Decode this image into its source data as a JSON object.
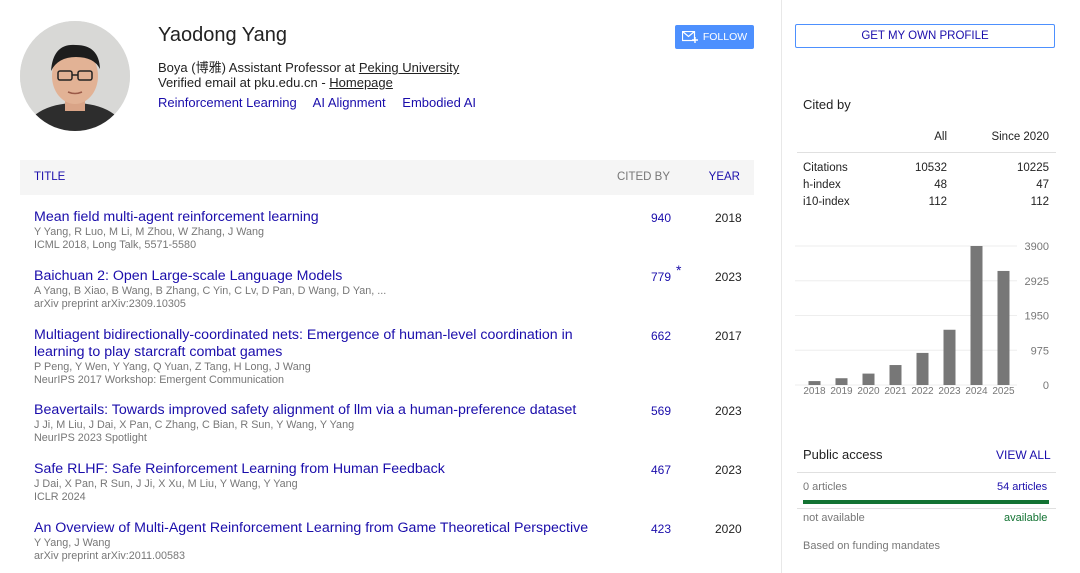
{
  "profile": {
    "name": "Yaodong Yang",
    "affiliation_prefix": "Boya (博雅) Assistant Professor at ",
    "affiliation_link": "Peking University",
    "email_text": "Verified email at pku.edu.cn - ",
    "homepage_link": "Homepage",
    "interests": [
      "Reinforcement Learning",
      "AI Alignment",
      "Embodied AI"
    ],
    "follow_label": "FOLLOW"
  },
  "table": {
    "col_title": "TITLE",
    "col_cited": "CITED BY",
    "col_year": "YEAR"
  },
  "articles": [
    {
      "title": "Mean field multi-agent reinforcement learning",
      "authors": "Y Yang, R Luo, M Li, M Zhou, W Zhang, J Wang",
      "venue": "ICML 2018, Long Talk, 5571-5580",
      "cites": "940",
      "year": "2018",
      "star": ""
    },
    {
      "title": "Baichuan 2: Open Large-scale Language Models",
      "authors": "A Yang, B Xiao, B Wang, B Zhang, C Yin, C Lv, D Pan, D Wang, D Yan, ...",
      "venue": "arXiv preprint arXiv:2309.10305",
      "cites": "779",
      "year": "2023",
      "star": "*"
    },
    {
      "title": "Multiagent bidirectionally-coordinated nets: Emergence of human-level coordination in learning to play starcraft combat games",
      "authors": "P Peng, Y Wen, Y Yang, Q Yuan, Z Tang, H Long, J Wang",
      "venue": "NeurIPS 2017 Workshop: Emergent Communication",
      "cites": "662",
      "year": "2017",
      "star": ""
    },
    {
      "title": "Beavertails: Towards improved safety alignment of llm via a human-preference dataset",
      "authors": "J Ji, M Liu, J Dai, X Pan, C Zhang, C Bian, R Sun, Y Wang, Y Yang",
      "venue": "NeurIPS 2023 Spotlight",
      "cites": "569",
      "year": "2023",
      "star": ""
    },
    {
      "title": "Safe RLHF: Safe Reinforcement Learning from Human Feedback",
      "authors": "J Dai, X Pan, R Sun, J Ji, X Xu, M Liu, Y Wang, Y Yang",
      "venue": "ICLR 2024",
      "cites": "467",
      "year": "2023",
      "star": ""
    },
    {
      "title": "An Overview of Multi-Agent Reinforcement Learning from Game Theoretical Perspective",
      "authors": "Y Yang, J Wang",
      "venue": "arXiv preprint arXiv:2011.00583",
      "cites": "423",
      "year": "2020",
      "star": ""
    }
  ],
  "sidebar": {
    "get_profile_label": "GET MY OWN PROFILE",
    "cited_by_title": "Cited by",
    "col_all": "All",
    "col_since": "Since 2020",
    "rows": [
      {
        "label": "Citations",
        "all": "10532",
        "since": "10225"
      },
      {
        "label": "h-index",
        "all": "48",
        "since": "47"
      },
      {
        "label": "i10-index",
        "all": "112",
        "since": "112"
      }
    ],
    "public_access": {
      "title": "Public access",
      "view_all": "VIEW ALL",
      "left1": "0 articles",
      "right1": "54 articles",
      "left2": "not available",
      "right2": "available",
      "note": "Based on funding mandates",
      "available_fraction": 1.0
    }
  },
  "chart_data": {
    "type": "bar",
    "categories": [
      "2018",
      "2019",
      "2020",
      "2021",
      "2022",
      "2023",
      "2024",
      "2025"
    ],
    "values": [
      110,
      190,
      320,
      560,
      900,
      1550,
      3900,
      3200
    ],
    "yticks": [
      0,
      975,
      1950,
      2925,
      3900
    ],
    "ylim": [
      0,
      3900
    ],
    "color": "#777777"
  },
  "colors": {
    "link": "#1a0dab",
    "follow_button": "#4d90fe",
    "header_bg": "#f5f5f5",
    "access_green": "#137333"
  }
}
